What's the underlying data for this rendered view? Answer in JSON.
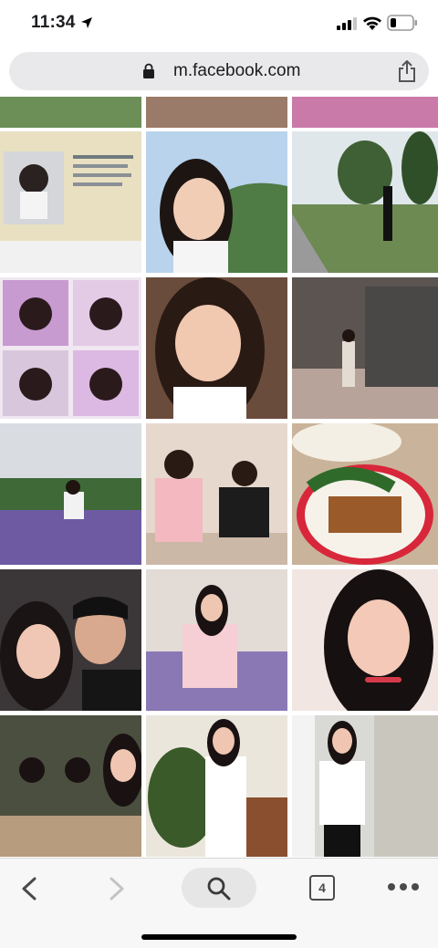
{
  "status_bar": {
    "time": "11:34",
    "icons": [
      "location-arrow-icon",
      "signal-icon",
      "wifi-icon",
      "battery-icon"
    ]
  },
  "browser": {
    "url": "m.facebook.com",
    "lock_icon": "lock-icon",
    "share_icon": "share-icon"
  },
  "gallery": {
    "photos": [
      {
        "label": "photo-partial-1",
        "color": "#6b8f57"
      },
      {
        "label": "photo-partial-2",
        "color": "#9a7a68"
      },
      {
        "label": "photo-partial-3",
        "color": "#c97aa8"
      },
      {
        "label": "driver-license-photo",
        "color": "#d7cfa4"
      },
      {
        "label": "selfie-forest-photo",
        "color": "#7aa0c4"
      },
      {
        "label": "path-trees-photo",
        "color": "#5f7a52"
      },
      {
        "label": "collage-photo",
        "color": "#d3a4cf"
      },
      {
        "label": "close-up-selfie-photo",
        "color": "#8b6a5a"
      },
      {
        "label": "temple-steps-photo",
        "color": "#6b5f58"
      },
      {
        "label": "lavender-field-photo",
        "color": "#6c5a9a"
      },
      {
        "label": "restaurant-couple-photo",
        "color": "#c9a2a8"
      },
      {
        "label": "food-plate-photo",
        "color": "#c5703e"
      },
      {
        "label": "couple-selfie-photo",
        "color": "#3e3a3c"
      },
      {
        "label": "cafe-chairs-photo",
        "color": "#b7a3c4"
      },
      {
        "label": "portrait-photo",
        "color": "#a3807a"
      },
      {
        "label": "group-dinner-photo",
        "color": "#4d5443"
      },
      {
        "label": "office-plant-photo",
        "color": "#b8b4aa"
      },
      {
        "label": "office-cabinet-photo",
        "color": "#c4c6c3"
      }
    ]
  },
  "toolbar": {
    "back_icon": "back-arrow-icon",
    "forward_icon": "forward-arrow-icon",
    "search_icon": "search-icon",
    "tab_count": "4",
    "more_icon": "more-dots-icon"
  }
}
